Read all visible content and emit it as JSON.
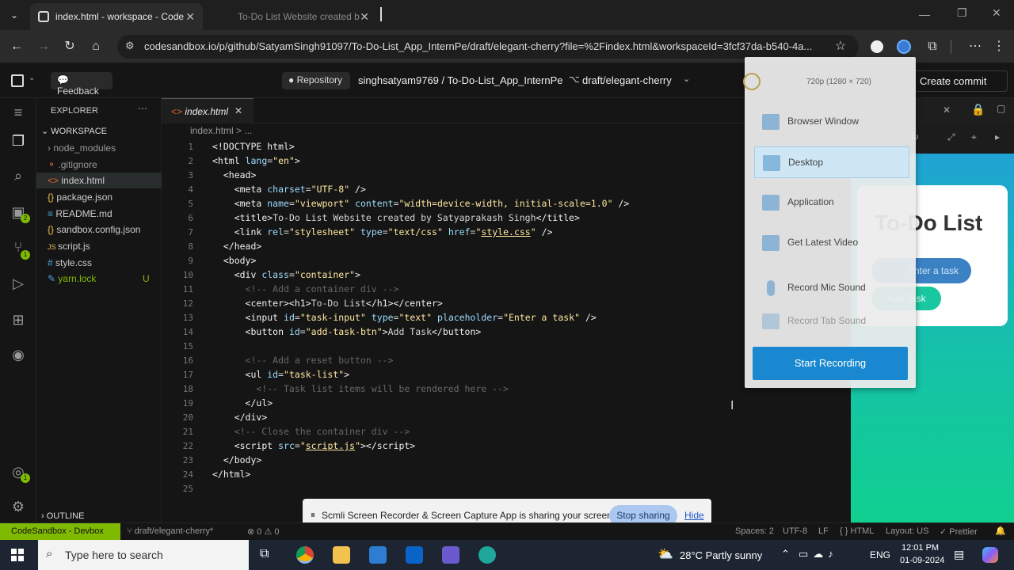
{
  "browser": {
    "tabs": [
      {
        "title": "index.html - workspace - Code"
      },
      {
        "title": "To-Do List Website created b"
      }
    ],
    "url": "codesandbox.io/p/github/SatyamSingh91097/To-Do-List_App_InternPe/draft/elegant-cherry?file=%2Findex.html&workspaceId=3fcf37da-b540-4a..."
  },
  "header": {
    "feedback": "Feedback",
    "repository": "Repository",
    "repo_path": "singhsatyam9769 / To-Do-List_App_InternPe",
    "branch": "draft/elegant-cherry",
    "create_commit": "Create commit"
  },
  "explorer": {
    "title": "EXPLORER",
    "workspace": "WORKSPACE",
    "files": [
      {
        "name": "node_modules"
      },
      {
        "name": ".gitignore"
      },
      {
        "name": "index.html"
      },
      {
        "name": "package.json"
      },
      {
        "name": "README.md"
      },
      {
        "name": "sandbox.config.json"
      },
      {
        "name": "script.js"
      },
      {
        "name": "style.css"
      },
      {
        "name": "yarn.lock",
        "badge": "U"
      }
    ],
    "outline": "OUTLINE"
  },
  "editor": {
    "tab": "index.html",
    "breadcrumb": "index.html > ..."
  },
  "preview": {
    "heading": "To-Do List",
    "input_placeholder": "Enter a task",
    "button": "Add Task"
  },
  "recorder": {
    "resolution": "720p (1280 × 720)",
    "items": [
      {
        "label": "Browser Window"
      },
      {
        "label": "Desktop"
      },
      {
        "label": "Application"
      },
      {
        "label": "Get Latest Video"
      },
      {
        "label": "Record Mic Sound"
      },
      {
        "label": "Record Tab Sound"
      }
    ],
    "start": "Start Recording"
  },
  "sharing": {
    "message": "Scmli Screen Recorder & Screen Capture App is sharing your screen.",
    "stop": "Stop sharing",
    "hide": "Hide"
  },
  "status": {
    "left": "CodeSandbox - Devbox",
    "branch": "draft/elegant-cherry*",
    "problems": "0 ⚠ 0",
    "spaces": "Spaces: 2",
    "encoding": "UTF-8",
    "eol": "LF",
    "lang": "HTML",
    "layout": "Layout: US",
    "prettier": "Prettier"
  },
  "taskbar": {
    "search": "Type here to search",
    "weather": "28°C  Partly sunny",
    "lang": "ENG",
    "time": "12:01 PM",
    "date": "01-09-2024"
  }
}
